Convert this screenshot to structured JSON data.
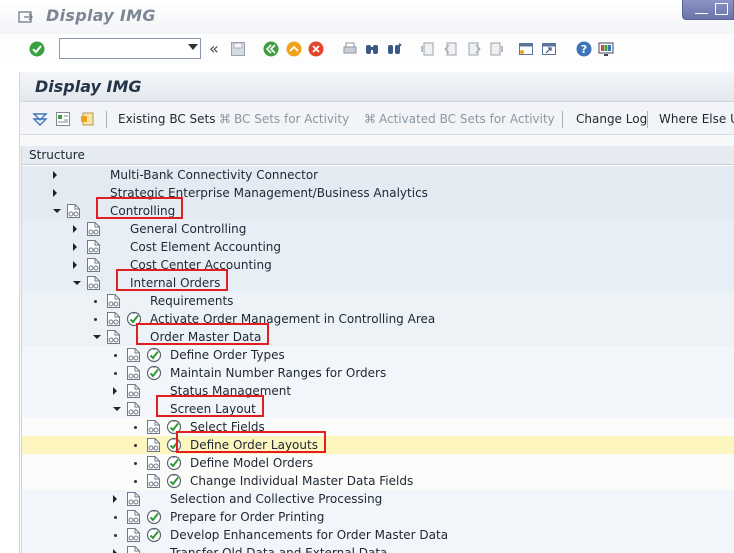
{
  "window": {
    "title": "Display IMG"
  },
  "screen": {
    "title": "Display IMG"
  },
  "toolbar": {
    "command_field_value": "",
    "icons": [
      "enter-icon",
      "save-icon",
      "back-icon",
      "exit-icon",
      "cancel-icon",
      "print-icon",
      "find-icon",
      "find-next-icon",
      "first-page-icon",
      "previous-page-icon",
      "next-page-icon",
      "last-page-icon",
      "new-session-icon",
      "shortcut-icon",
      "help-icon",
      "customize-layout-icon"
    ]
  },
  "appbar": {
    "existing_bc_sets": "Existing BC Sets",
    "bc_sets_for_activity": "BC Sets for Activity",
    "activated_bc_sets": "Activated BC Sets for Activity",
    "change_log": "Change Log",
    "where_else_used": "Where Else Us"
  },
  "tree": {
    "header": "Structure",
    "rows": [
      {
        "label": "Multi-Bank Connectivity Connector"
      },
      {
        "label": "Strategic Enterprise Management/Business Analytics"
      },
      {
        "label": "Controlling"
      },
      {
        "label": "General Controlling"
      },
      {
        "label": "Cost Element Accounting"
      },
      {
        "label": "Cost Center Accounting"
      },
      {
        "label": "Internal Orders"
      },
      {
        "label": "Requirements"
      },
      {
        "label": "Activate Order Management in Controlling Area"
      },
      {
        "label": "Order Master Data"
      },
      {
        "label": "Define Order Types"
      },
      {
        "label": "Maintain Number Ranges for Orders"
      },
      {
        "label": "Status Management"
      },
      {
        "label": "Screen Layout"
      },
      {
        "label": "Select Fields"
      },
      {
        "label": "Define Order Layouts"
      },
      {
        "label": "Define Model Orders"
      },
      {
        "label": "Change Individual Master Data Fields"
      },
      {
        "label": "Selection and Collective Processing"
      },
      {
        "label": "Prepare for Order Printing"
      },
      {
        "label": "Develop Enhancements for Order Master Data"
      },
      {
        "label": "Transfer Old Data and External Data"
      }
    ]
  },
  "colors": {
    "selected_row": "#fdf7bf",
    "highlight_box": "#e02020",
    "tree_band": "#e3eaf2"
  }
}
